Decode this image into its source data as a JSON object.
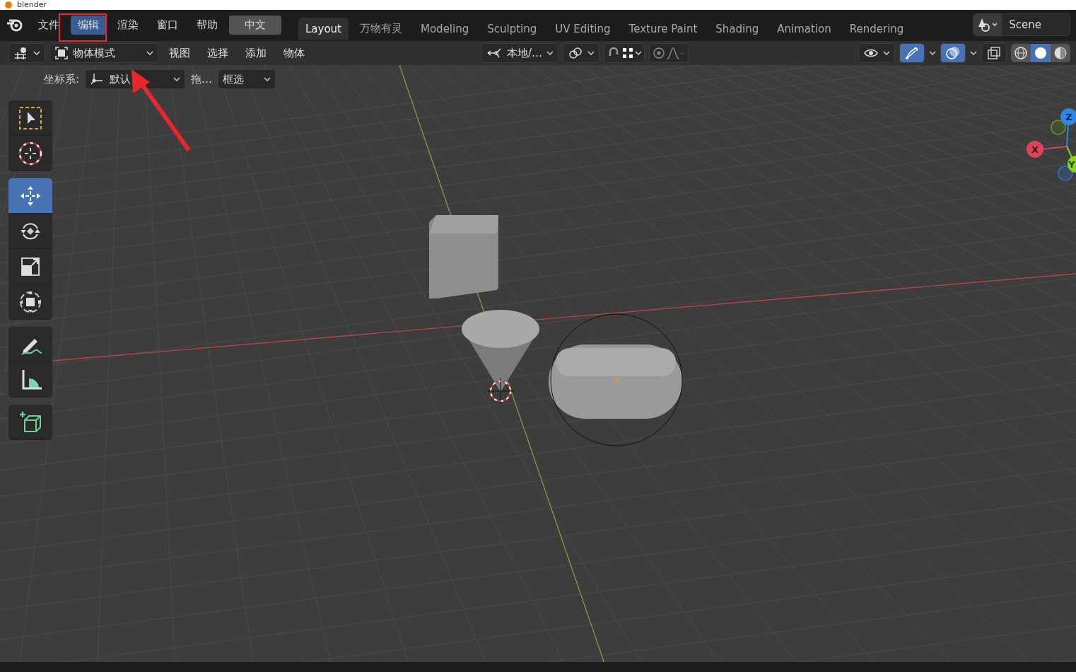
{
  "window": {
    "title": "blender"
  },
  "menu": [
    {
      "label": "文件",
      "selected": false
    },
    {
      "label": "编辑",
      "selected": true
    },
    {
      "label": "渲染",
      "selected": false
    },
    {
      "label": "窗口",
      "selected": false
    },
    {
      "label": "帮助",
      "selected": false
    }
  ],
  "language_button": "中文",
  "workspaces": [
    {
      "label": "Layout",
      "selected": true
    },
    {
      "label": "万物有灵",
      "selected": false
    },
    {
      "label": "Modeling",
      "selected": false
    },
    {
      "label": "Sculpting",
      "selected": false
    },
    {
      "label": "UV Editing",
      "selected": false
    },
    {
      "label": "Texture Paint",
      "selected": false
    },
    {
      "label": "Shading",
      "selected": false
    },
    {
      "label": "Animation",
      "selected": false
    },
    {
      "label": "Rendering",
      "selected": false
    }
  ],
  "scene": "Scene",
  "header": {
    "mode": "物体模式",
    "menus": [
      "视图",
      "选择",
      "添加",
      "物体"
    ],
    "pivot": "本地/…",
    "snap_on": false,
    "proportional_on": false,
    "gizmo_on": true,
    "overlay_on": true,
    "shading": [
      {
        "kind": "wireframe",
        "selected": false
      },
      {
        "kind": "solid",
        "selected": true
      },
      {
        "kind": "material",
        "selected": false
      }
    ]
  },
  "tool_settings": {
    "orientation_label": "坐标系:",
    "orientation_value": "默认",
    "drag_label": "拖…",
    "select_value": "框选"
  },
  "toolbar": [
    [
      {
        "kind": "select",
        "selected": false
      },
      {
        "kind": "cursor",
        "selected": false
      }
    ],
    [
      {
        "kind": "move",
        "selected": true
      },
      {
        "kind": "rotate",
        "selected": false
      },
      {
        "kind": "scale",
        "selected": false
      },
      {
        "kind": "transform",
        "selected": false
      }
    ],
    [
      {
        "kind": "annotate",
        "selected": false
      },
      {
        "kind": "measure",
        "selected": false
      }
    ],
    [
      {
        "kind": "add_cube",
        "selected": false
      }
    ]
  ],
  "gizmo": {
    "x": "X",
    "y": "Y",
    "z": "Z"
  }
}
